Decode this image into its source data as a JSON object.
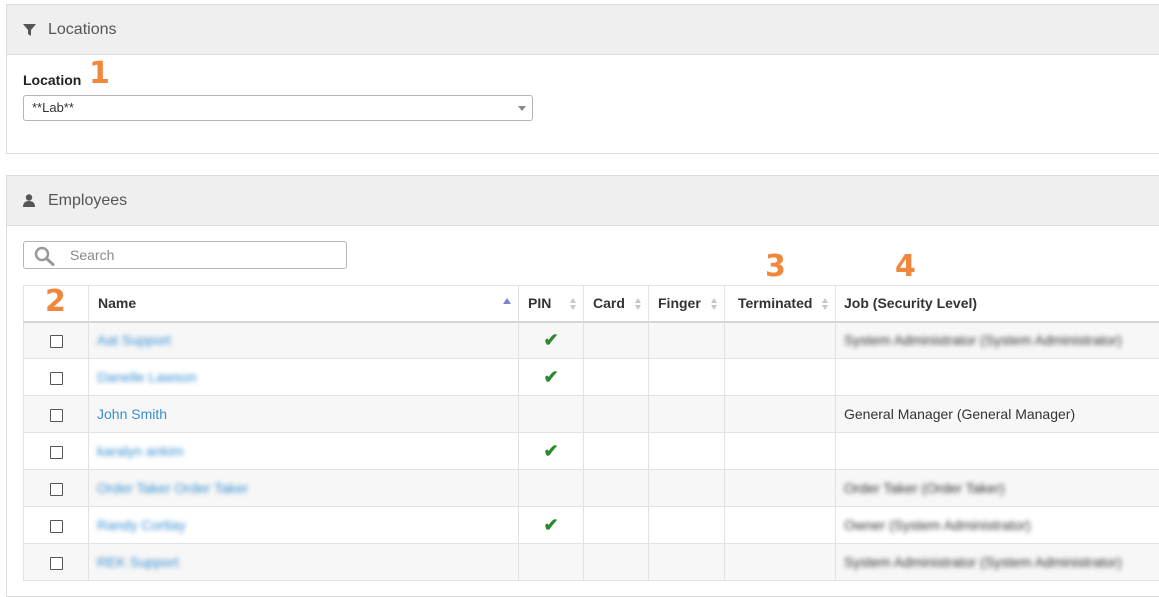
{
  "locations_panel": {
    "title": "Locations",
    "location_label": "Location",
    "location_value": "**Lab**"
  },
  "employees_panel": {
    "title": "Employees",
    "search_placeholder": "Search"
  },
  "annotations": {
    "a1": "1",
    "a2": "2",
    "a3": "3",
    "a4": "4"
  },
  "table": {
    "columns": {
      "name": "Name",
      "pin": "PIN",
      "card": "Card",
      "finger": "Finger",
      "terminated": "Terminated",
      "job": "Job (Security Level)"
    },
    "rows": [
      {
        "name": "Aat Support",
        "pin": "✔",
        "card": "",
        "finger": "",
        "terminated": "",
        "job": "System Administrator (System Administrator)"
      },
      {
        "name": "Danelle Lawson",
        "pin": "✔",
        "card": "",
        "finger": "",
        "terminated": "",
        "job": ""
      },
      {
        "name": "John Smith",
        "pin": "",
        "card": "",
        "finger": "",
        "terminated": "",
        "job": "General Manager (General Manager)"
      },
      {
        "name": "karalyn ankim",
        "pin": "✔",
        "card": "",
        "finger": "",
        "terminated": "",
        "job": ""
      },
      {
        "name": "Order Taker Order Taker",
        "pin": "",
        "card": "",
        "finger": "",
        "terminated": "",
        "job": "Order Taker (Order Taker)"
      },
      {
        "name": "Randy Cortlay",
        "pin": "✔",
        "card": "",
        "finger": "",
        "terminated": "",
        "job": "Owner (System Administrator)"
      },
      {
        "name": "REK Support",
        "pin": "",
        "card": "",
        "finger": "",
        "terminated": "",
        "job": "System Administrator (System Administrator)"
      }
    ]
  },
  "colors": {
    "annotation": "#f0873c",
    "link": "#3a8fd0",
    "check": "#2b8a2b",
    "panel_header": "#efefef"
  }
}
